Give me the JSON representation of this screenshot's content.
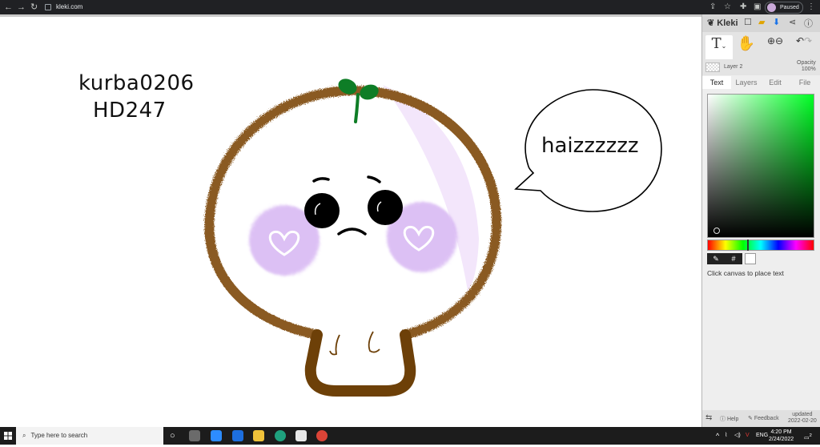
{
  "browser": {
    "url": "kleki.com",
    "profile_status": "Paused"
  },
  "canvas": {
    "watermark_line1": "kurba0206",
    "watermark_line2": "HD247",
    "speech_bubble_text": "haizzzzzz"
  },
  "panel": {
    "app_name": "Kleki",
    "layer_name": "Layer 2",
    "opacity_label": "Opacity",
    "opacity_value": "100%",
    "tabs": [
      {
        "label": "Text",
        "active": true
      },
      {
        "label": "Layers",
        "active": false
      },
      {
        "label": "Edit",
        "active": false
      },
      {
        "label": "File",
        "active": false
      }
    ],
    "hex_button": "#",
    "hint": "Click canvas to place text",
    "help_label": "Help",
    "feedback_label": "Feedback",
    "updated_label": "updated",
    "updated_date": "2022-02-20",
    "current_color": "#ffffff",
    "hue_color": "#00ff25"
  },
  "taskbar": {
    "search_placeholder": "Type here to search",
    "language": "ENG",
    "time": "4:20 PM",
    "date": "2/24/2022",
    "notification_count": "2"
  }
}
